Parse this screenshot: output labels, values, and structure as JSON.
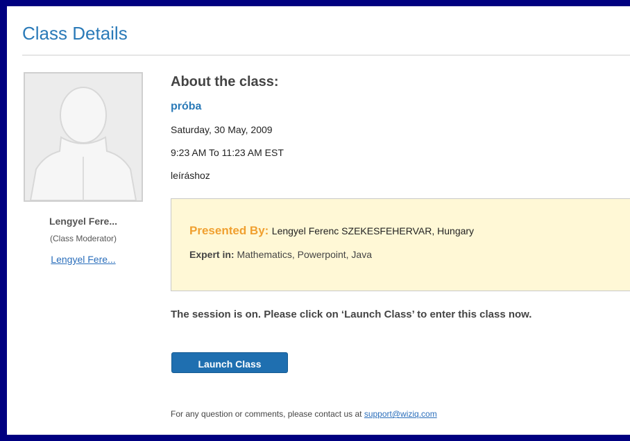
{
  "page": {
    "title": "Class Details"
  },
  "moderator": {
    "avatar_icon": "user-silhouette-icon",
    "name": "Lengyel Fere...",
    "role": "(Class Moderator)",
    "link_text": "Lengyel Fere..."
  },
  "about": {
    "heading": "About the class:",
    "class_name": "próba",
    "date": "Saturday, 30 May, 2009",
    "time": "9:23 AM To 11:23 AM EST",
    "description": "leíráshoz"
  },
  "presenter": {
    "label": "Presented By:",
    "value": "Lengyel Ferenc SZEKESFEHERVAR, Hungary",
    "expert_label": "Expert in:",
    "expert_value": "Mathematics, Powerpoint, Java"
  },
  "session": {
    "message": "The session is on. Please click on ‘Launch Class’ to enter this class now.",
    "launch_label": "Launch Class"
  },
  "footer": {
    "text": "For any question or comments, please contact us at",
    "email": "support@wiziq.com"
  },
  "colors": {
    "frame_border": "#000080",
    "title": "#2a7ab8",
    "presented_label": "#f0a030",
    "presenter_box_bg": "#fff8d6",
    "button": "#1f6fb0"
  }
}
